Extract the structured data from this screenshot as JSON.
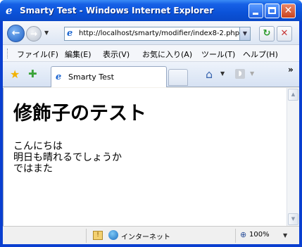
{
  "window": {
    "title": "Smarty Test - Windows Internet Explorer"
  },
  "address": {
    "url": "http://localhost/smarty/modifier/index8-2.php"
  },
  "menu": {
    "items": [
      {
        "label": "ファイル(F)"
      },
      {
        "label": "編集(E)"
      },
      {
        "label": "表示(V)"
      },
      {
        "label": "お気に入り(A)"
      },
      {
        "label": "ツール(T)"
      },
      {
        "label": "ヘルプ(H)"
      }
    ]
  },
  "tabs": [
    {
      "label": "Smarty Test"
    }
  ],
  "page": {
    "heading": "修飾子のテスト",
    "lines": [
      "こんにちは",
      "明日も晴れるでしょうか",
      "ではまた"
    ]
  },
  "status": {
    "zone": "インターネット",
    "zoom": "100%"
  },
  "icons": {
    "back": "back-arrow-icon",
    "forward": "forward-arrow-icon",
    "refresh": "refresh-icon",
    "stop": "stop-icon",
    "favorites": "favorites-star-icon",
    "add_favorite": "add-favorite-icon",
    "home": "home-icon",
    "feeds": "feeds-icon"
  },
  "colors": {
    "titlebar": "#0b52d8",
    "content_bg": "#ffffff"
  }
}
